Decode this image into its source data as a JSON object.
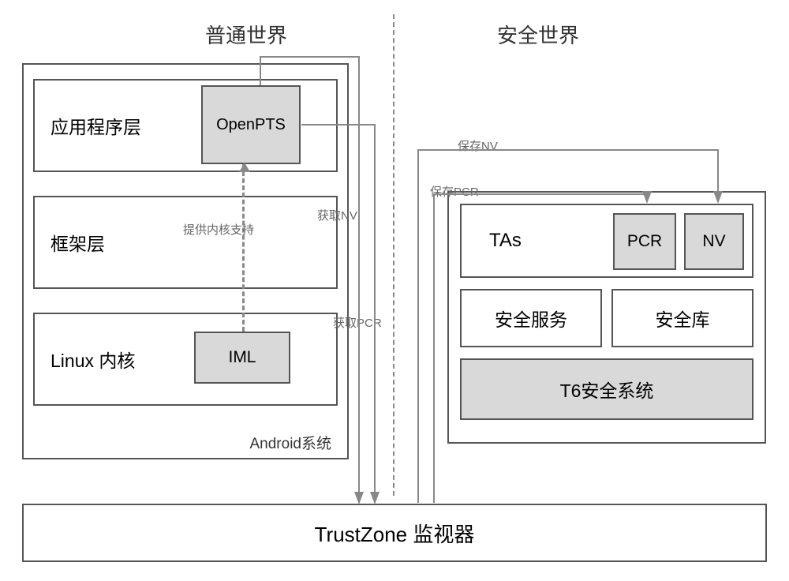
{
  "titles": {
    "normal_world": "普通世界",
    "secure_world": "安全世界"
  },
  "android": {
    "label": "Android系统",
    "app_layer": "应用程序层",
    "framework_layer": "框架层",
    "kernel_layer": "Linux 内核",
    "openpts": "OpenPTS",
    "iml": "IML"
  },
  "secure": {
    "tas": "TAs",
    "pcr": "PCR",
    "nv": "NV",
    "security_service": "安全服务",
    "security_lib": "安全库",
    "t6_system": "T6安全系统"
  },
  "trustzone": "TrustZone 监视器",
  "arrows": {
    "kernel_support": "提供内核支持",
    "get_nv": "获取NV",
    "get_pcr": "获取PCR",
    "save_nv": "保存NV",
    "save_pcr": "保存PCR"
  }
}
